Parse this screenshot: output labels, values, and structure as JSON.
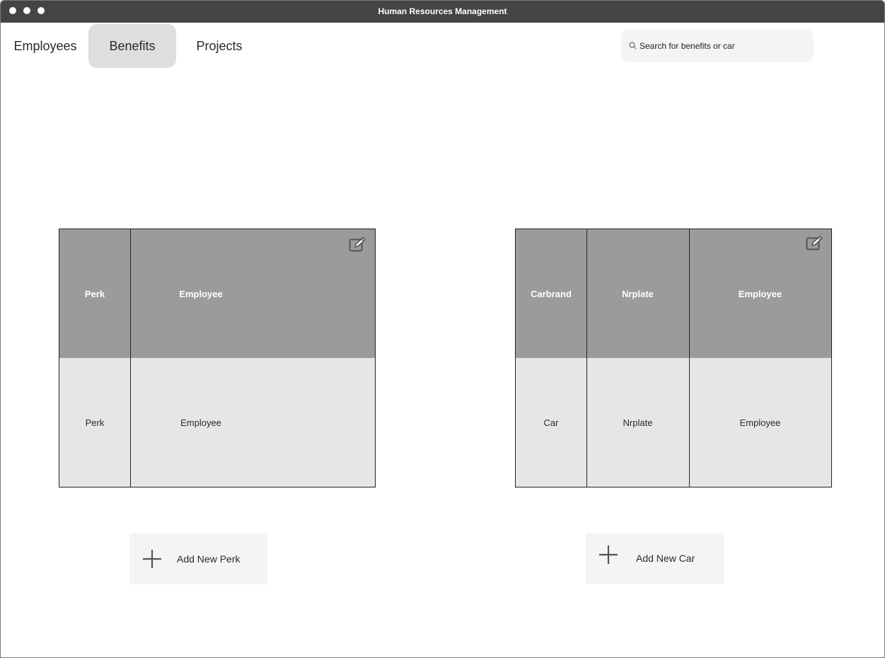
{
  "window": {
    "title": "Human Resources Management"
  },
  "nav": {
    "tabs": [
      {
        "label": "Employees",
        "active": false
      },
      {
        "label": "Benefits",
        "active": true
      },
      {
        "label": "Projects",
        "active": false
      }
    ]
  },
  "search": {
    "placeholder": "Search for benefits or car",
    "icon": "search-icon"
  },
  "perks_table": {
    "headers": [
      "Perk",
      "Employee"
    ],
    "rows": [
      [
        "Perk",
        "Employee"
      ]
    ],
    "edit_icon": "edit-icon"
  },
  "cars_table": {
    "headers": [
      "Carbrand",
      "Nrplate",
      "Employee"
    ],
    "rows": [
      [
        "Car",
        "Nrplate",
        "Employee"
      ]
    ],
    "edit_icon": "edit-icon"
  },
  "buttons": {
    "add_perk": "Add New Perk",
    "add_car": "Add New Car"
  },
  "colors": {
    "titlebar": "#444444",
    "header_cell": "#9b9b9b",
    "body_cell": "#e6e6e6",
    "active_tab": "#dedede",
    "button_bg": "#f4f4f4"
  }
}
